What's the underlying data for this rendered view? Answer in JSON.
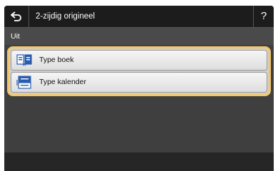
{
  "header": {
    "title": "2-zijdig origineel",
    "help_label": "?"
  },
  "status": {
    "current_value": "Uit"
  },
  "options": [
    {
      "label": "Type boek",
      "icon": "book-type-icon"
    },
    {
      "label": "Type kalender",
      "icon": "calendar-type-icon"
    }
  ],
  "colors": {
    "selection_border": "#f3c66a",
    "panel_background": "#3f3f3f",
    "titlebar_background": "#1c1c1c",
    "icon_blue": "#2a5db0"
  }
}
